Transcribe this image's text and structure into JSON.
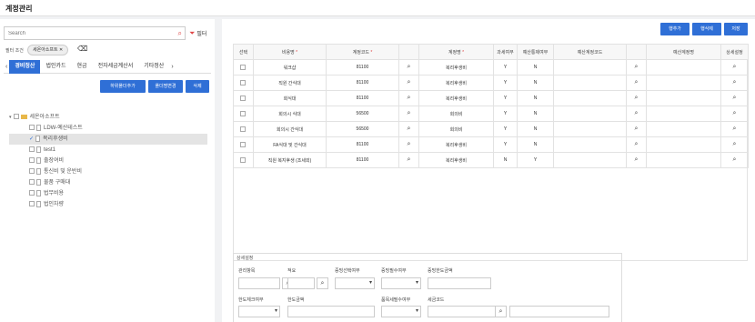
{
  "window": {
    "title": "계정관리"
  },
  "left": {
    "search_placeholder": "Search",
    "filter_label": "필터",
    "filter_condition_label": "필터 조건",
    "chip_label": "세온아소프트 ✕",
    "tabs": [
      "경비정산",
      "법인카드",
      "현금",
      "전자세금계산서",
      "기타정산"
    ],
    "buttons": {
      "add_subfolder": "하위폴더추가",
      "rename_folder": "폴더명변경",
      "delete": "삭제"
    },
    "tree": {
      "root": "세온아소프트",
      "items": [
        "LDW-예산테스트",
        "복리후생비",
        "test1",
        "출장여비",
        "통신비 및 운반비",
        "물품 구매대",
        "법무비용",
        "법인차량"
      ]
    }
  },
  "right": {
    "buttons": {
      "add_row": "행추가",
      "delete_row": "행삭제",
      "save": "저장"
    },
    "columns": [
      "선택",
      "비용명",
      "계정코드",
      "",
      "계정명",
      "과세여부",
      "예산통제여부",
      "예산계정코드",
      "",
      "예산계정명",
      "상세설정"
    ],
    "rows": [
      [
        "",
        "워크샵",
        "81100",
        "",
        "복리후생비",
        "Y",
        "N",
        "",
        "",
        "",
        ""
      ],
      [
        "",
        "직원 간식대",
        "81100",
        "",
        "복리후생비",
        "Y",
        "N",
        "",
        "",
        "",
        ""
      ],
      [
        "",
        "회식대",
        "81100",
        "",
        "복리후생비",
        "Y",
        "N",
        "",
        "",
        "",
        ""
      ],
      [
        "",
        "회의시 식대",
        "56500",
        "",
        "회의비",
        "Y",
        "N",
        "",
        "",
        "",
        ""
      ],
      [
        "",
        "회의시 간식대",
        "56500",
        "",
        "회의비",
        "Y",
        "N",
        "",
        "",
        "",
        ""
      ],
      [
        "",
        "FA식대 및 간식대",
        "81100",
        "",
        "복리후생비",
        "Y",
        "N",
        "",
        "",
        "",
        ""
      ],
      [
        "",
        "직원 복지후생 (조세외)",
        "81100",
        "",
        "복리후생비",
        "N",
        "Y",
        "",
        "",
        "",
        ""
      ]
    ],
    "detail": {
      "title": "상세설정",
      "labels": {
        "mgmt_item": "관리항목",
        "summary": "적요",
        "evidence_select": "증빙선택여부",
        "evidence_required": "증빙필수여부",
        "evidence_limit": "증빙한도금액",
        "limit_check": "한도체크여부",
        "limit_amount": "한도금액",
        "project_required": "품목세필수여부",
        "tax_code": "세금코드"
      }
    }
  }
}
